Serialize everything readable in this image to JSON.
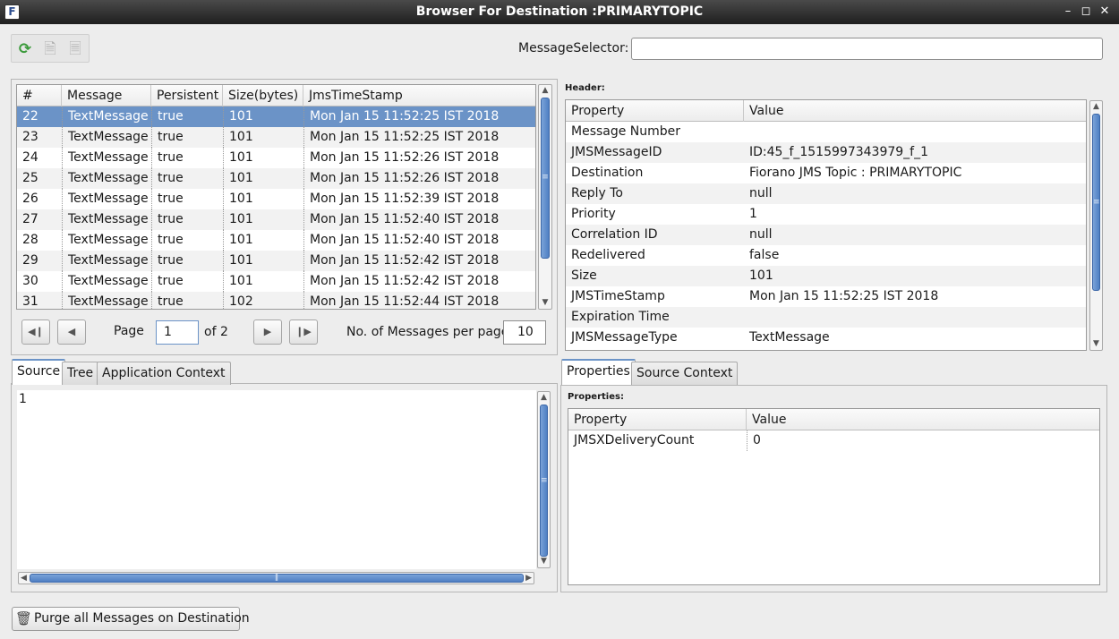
{
  "window": {
    "title": "Browser For Destination :PRIMARYTOPIC",
    "controls": [
      "minimize",
      "maximize",
      "close"
    ]
  },
  "toolbar": {
    "icons": [
      "refresh-icon",
      "save-message-icon",
      "forward-message-icon"
    ]
  },
  "selector": {
    "label": "MessageSelector:",
    "value": ""
  },
  "messages": {
    "columns": [
      "#",
      "Message",
      "Persistent",
      "Size(bytes)",
      "JmsTimeStamp"
    ],
    "rows": [
      [
        "22",
        "TextMessage",
        "true",
        "101",
        "Mon Jan 15 11:52:25 IST 2018"
      ],
      [
        "23",
        "TextMessage",
        "true",
        "101",
        "Mon Jan 15 11:52:25 IST 2018"
      ],
      [
        "24",
        "TextMessage",
        "true",
        "101",
        "Mon Jan 15 11:52:26 IST 2018"
      ],
      [
        "25",
        "TextMessage",
        "true",
        "101",
        "Mon Jan 15 11:52:26 IST 2018"
      ],
      [
        "26",
        "TextMessage",
        "true",
        "101",
        "Mon Jan 15 11:52:39 IST 2018"
      ],
      [
        "27",
        "TextMessage",
        "true",
        "101",
        "Mon Jan 15 11:52:40 IST 2018"
      ],
      [
        "28",
        "TextMessage",
        "true",
        "101",
        "Mon Jan 15 11:52:40 IST 2018"
      ],
      [
        "29",
        "TextMessage",
        "true",
        "101",
        "Mon Jan 15 11:52:42 IST 2018"
      ],
      [
        "30",
        "TextMessage",
        "true",
        "101",
        "Mon Jan 15 11:52:42 IST 2018"
      ],
      [
        "31",
        "TextMessage",
        "true",
        "102",
        "Mon Jan 15 11:52:44 IST 2018"
      ]
    ],
    "selected_index": 0
  },
  "pagination": {
    "page_label": "Page",
    "page_value": "1",
    "of_label": "of 2",
    "per_page_label": "No. of Messages per page",
    "per_page_value": "10"
  },
  "header": {
    "label": "Header:",
    "columns": [
      "Property",
      "Value"
    ],
    "rows": [
      [
        "Message Number",
        ""
      ],
      [
        "JMSMessageID",
        "ID:45_f_1515997343979_f_1"
      ],
      [
        "Destination",
        "Fiorano JMS Topic : PRIMARYTOPIC"
      ],
      [
        "Reply To",
        "null"
      ],
      [
        "Priority",
        "1"
      ],
      [
        "Correlation ID",
        "null"
      ],
      [
        "Redelivered",
        "false"
      ],
      [
        "Size",
        "101"
      ],
      [
        "JMSTimeStamp",
        "Mon Jan 15 11:52:25 IST 2018"
      ],
      [
        "Expiration Time",
        ""
      ],
      [
        "JMSMessageType",
        "TextMessage"
      ]
    ]
  },
  "left_tabs": {
    "items": [
      "Source",
      "Tree",
      "Application Context"
    ],
    "active": 0
  },
  "source": {
    "content": "1"
  },
  "right_tabs": {
    "items": [
      "Properties",
      "Source Context"
    ],
    "active": 0
  },
  "properties": {
    "label": "Properties:",
    "columns": [
      "Property",
      "Value"
    ],
    "rows": [
      [
        "JMSXDeliveryCount",
        "0"
      ]
    ]
  },
  "purge": {
    "label": "Purge all Messages on Destination"
  }
}
